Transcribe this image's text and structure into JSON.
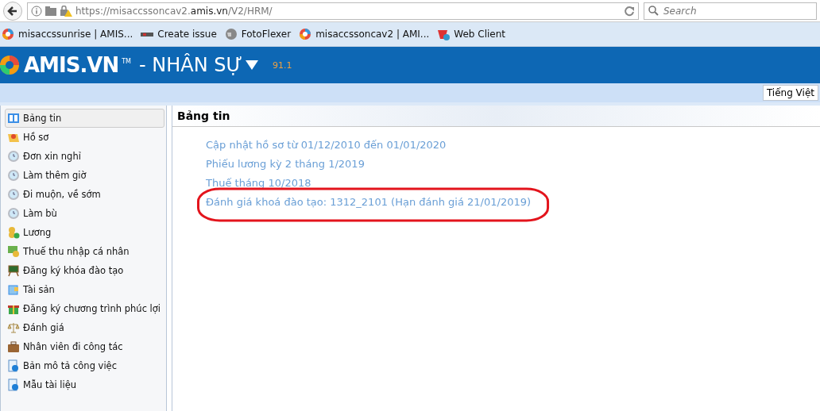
{
  "browser": {
    "url_prefix": "https://misaccssoncav2.",
    "url_domain": "amis.vn",
    "url_path": "/V2/HRM/",
    "search": {
      "placeholder": "Search"
    }
  },
  "bookmarks": [
    {
      "label": "misaccssunrise | AMIS..."
    },
    {
      "label": "Create issue"
    },
    {
      "label": "FotoFlexer"
    },
    {
      "label": "misaccssoncav2 | AMI..."
    },
    {
      "label": "Web Client"
    }
  ],
  "header": {
    "logo": "AMIS.VN",
    "tm": "TM",
    "title": "- NHÂN SỰ",
    "version": "91.1"
  },
  "language_button": "Tiếng Việt",
  "sidebar": {
    "items": [
      {
        "label": "Bảng tin",
        "selected": true
      },
      {
        "label": "Hồ sơ",
        "selected": false
      },
      {
        "label": "Đơn xin nghỉ",
        "selected": false
      },
      {
        "label": "Làm thêm giờ",
        "selected": false
      },
      {
        "label": "Đi muộn, về sớm",
        "selected": false
      },
      {
        "label": "Làm bù",
        "selected": false
      },
      {
        "label": "Lương",
        "selected": false
      },
      {
        "label": "Thuế thu nhập cá nhân",
        "selected": false
      },
      {
        "label": "Đăng ký khóa đào tạo",
        "selected": false
      },
      {
        "label": "Tài sản",
        "selected": false
      },
      {
        "label": "Đăng ký chương trình phúc lợi",
        "selected": false
      },
      {
        "label": "Đánh giá",
        "selected": false
      },
      {
        "label": "Nhân viên đi công tác",
        "selected": false
      },
      {
        "label": "Bản mô tả công việc",
        "selected": false
      },
      {
        "label": "Mẫu tài liệu",
        "selected": false
      }
    ]
  },
  "panel": {
    "title": "Bảng tin",
    "news": [
      {
        "text": "Cập nhật hồ sơ từ 01/12/2010 đến 01/01/2020",
        "circled": false
      },
      {
        "text": "Phiếu lương kỳ 2 tháng 1/2019",
        "circled": false
      },
      {
        "text": "Thuế tháng 10/2018",
        "circled": false
      },
      {
        "text": "Đánh giá khoá đào tạo: 1312_2101 (Hạn đánh giá 21/01/2019)",
        "circled": true
      }
    ]
  }
}
